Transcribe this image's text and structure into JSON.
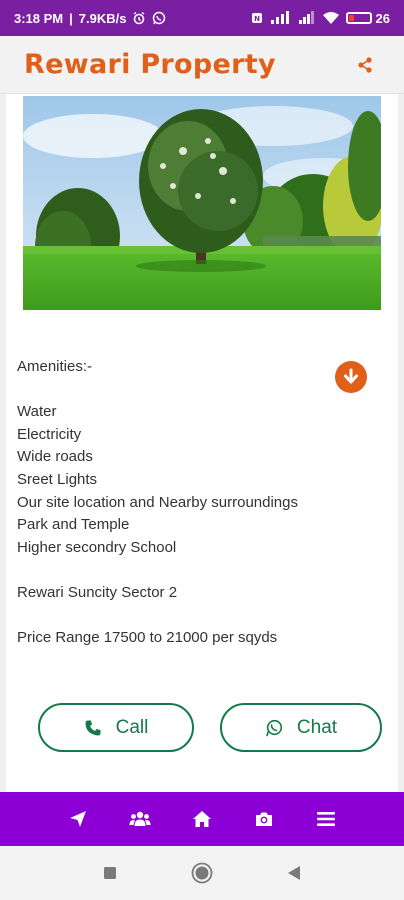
{
  "status_bar": {
    "time": "3:18 PM",
    "net_speed": "7.9KB/s",
    "battery": "26",
    "battery_level": 0.26,
    "icons": [
      "alarm-icon",
      "whatsapp-icon",
      "vibrate-icon",
      "signal-icon",
      "wifi-icon",
      "battery-icon"
    ]
  },
  "app_bar": {
    "title": "Rewari Property",
    "share_icon": "share-icon"
  },
  "content": {
    "image_desc": "tree-on-grass-photo",
    "download_icon": "download-icon",
    "lines": [
      "Amenities:-",
      "",
      "Water",
      "Electricity",
      "Wide roads",
      "Sreet Lights",
      "Our site location and Nearby surroundings",
      "Park and Temple",
      "Higher secondry School",
      "",
      "Rewari Suncity Sector 2",
      "",
      "Price Range 17500 to 21000 per sqyds"
    ]
  },
  "actions": {
    "call_label": "Call",
    "chat_label": "Chat"
  },
  "bottom_nav": {
    "items": [
      "send-icon",
      "users-icon",
      "home-icon",
      "camera-icon",
      "menu-icon"
    ]
  },
  "system_nav": {
    "items": [
      "recents-button",
      "home-button",
      "back-button"
    ]
  },
  "colors": {
    "accent": "#e0601a",
    "nav_purple": "#8c00d6",
    "button_green": "#147a4a"
  }
}
